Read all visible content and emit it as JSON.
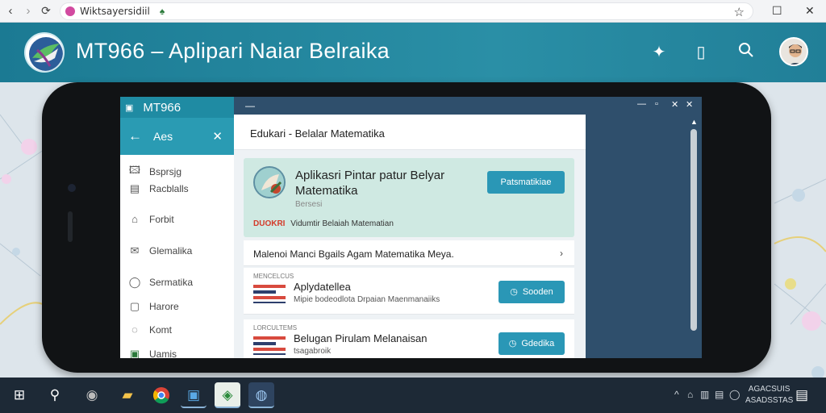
{
  "browser": {
    "address": "Wiktsayersidiil",
    "nav": {
      "back": "‹",
      "forward": "›",
      "reload": "⟳"
    }
  },
  "app": {
    "title": "MT966 – Aplipari Naiar Belraika"
  },
  "sidebar": {
    "app_name": "MT966",
    "header_label": "Aes",
    "items": [
      {
        "label": "Bsprsjg",
        "icon": "image-icon"
      },
      {
        "label": "Racblalls",
        "icon": "notes-icon"
      },
      {
        "label": "Forbit",
        "icon": "home-icon"
      },
      {
        "label": "Glemalika",
        "icon": "mail-icon"
      },
      {
        "label": "Sermatika",
        "icon": "chat-icon"
      },
      {
        "label": "Harore",
        "icon": "folder-icon"
      },
      {
        "label": "Komt",
        "icon": "bell-icon"
      },
      {
        "label": "Uamis",
        "icon": "calendar-icon"
      }
    ]
  },
  "content": {
    "title": "Edukari - Belalar Matematika",
    "hero": {
      "title": "Aplikasri Pintar patur Belyar Matematika",
      "subtitle": "Bersesi",
      "tag_red": "DUOKRI",
      "tag_text": "Vidumtir Belaiah Matematian",
      "button": "Patsmatikiae"
    },
    "banner": "Malenoi Manci Bgails Agam Matematika Meya.",
    "cards": [
      {
        "tiny": "MENCELCUS",
        "title": "Aplydatellea",
        "subtitle": "Mipie bodeodlota Drpaian Maenmanaiiks",
        "button": "Sooden"
      },
      {
        "tiny": "LORCULTEMS",
        "title": "Belugan Pirulam Melanaisan",
        "subtitle": "tsagabroik",
        "button": "Gdedika"
      }
    ]
  },
  "taskbar": {
    "clock_line1": "AGACSUIS",
    "clock_line2": "ASADSSTAS"
  },
  "colors": {
    "header": "#1b7a93",
    "accent_button": "#2a97b6",
    "sidebar_head": "#2a9bb3",
    "taskbar": "#1d2936"
  }
}
